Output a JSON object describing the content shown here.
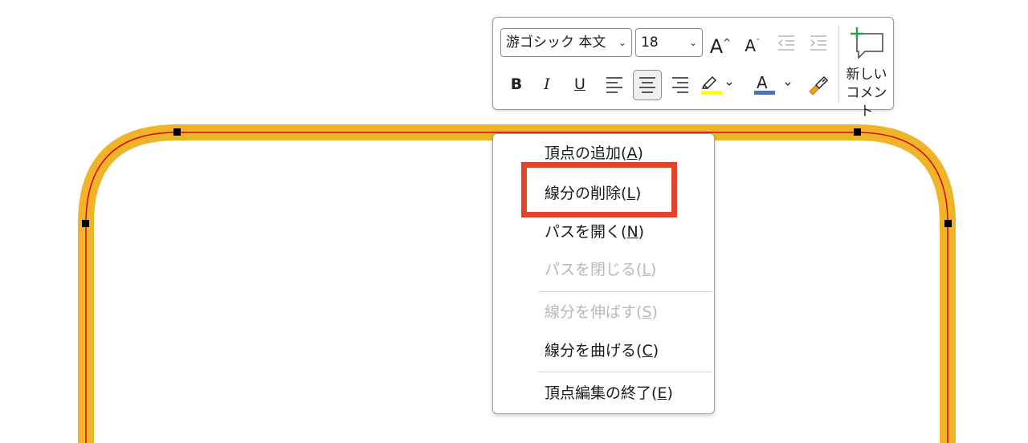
{
  "toolbar": {
    "font_name": "游ゴシック 本文",
    "font_size": "18",
    "grow_font": "A",
    "shrink_font": "A",
    "bold": "B",
    "italic": "I",
    "underline": "U",
    "font_color_letter": "A",
    "highlight_color": "#ffff00",
    "font_color": "#4472c4",
    "new_comment_line1": "新しい",
    "new_comment_line2": "コメント"
  },
  "context_menu": {
    "items": [
      {
        "label": "頂点の追加",
        "key": "A",
        "disabled": false
      },
      {
        "label": "線分の削除",
        "key": "L",
        "disabled": false
      },
      {
        "label": "パスを開く",
        "key": "N",
        "disabled": false
      },
      {
        "label": "パスを閉じる",
        "key": "L",
        "disabled": true
      },
      {
        "label": "線分を伸ばす",
        "key": "S",
        "disabled": true
      },
      {
        "label": "線分を曲げる",
        "key": "C",
        "disabled": false
      },
      {
        "label": "頂点編集の終了",
        "key": "E",
        "disabled": false
      }
    ],
    "highlighted_item": "線分の削除",
    "highlight_color": "#e0442a"
  },
  "shape": {
    "fill_stroke_color": "#f0b429",
    "path_color": "#e00000"
  }
}
